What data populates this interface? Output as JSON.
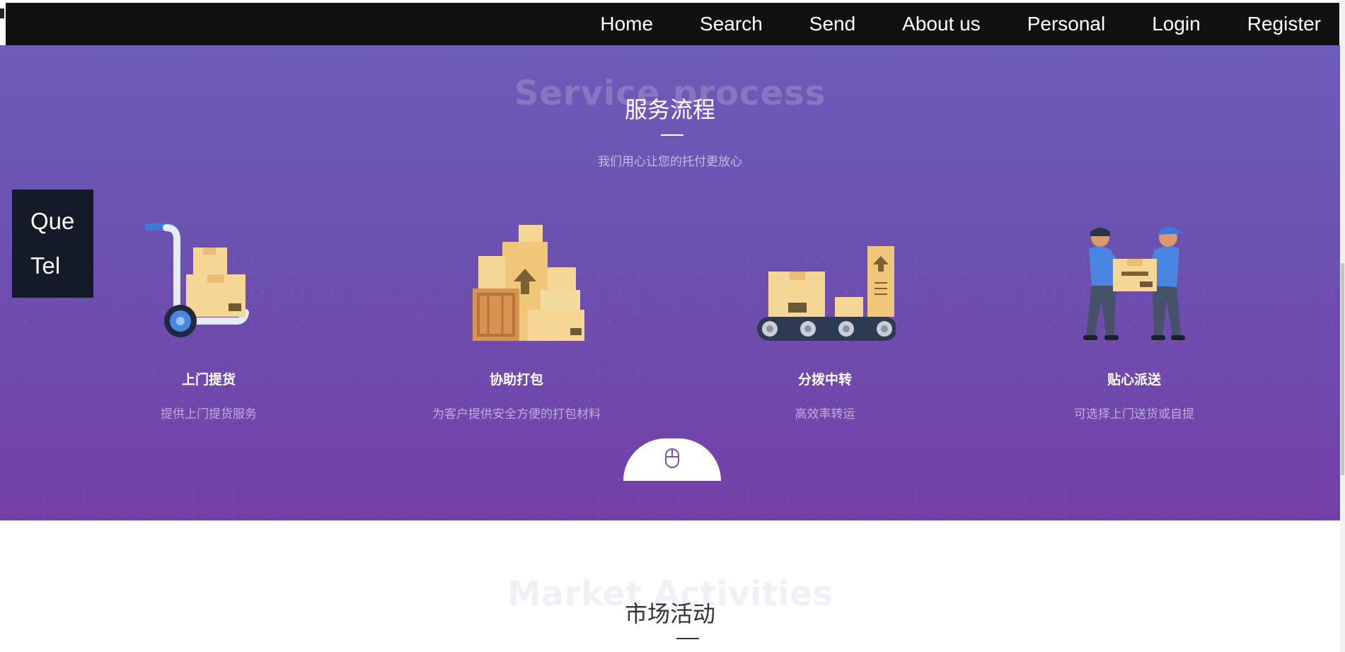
{
  "nav": {
    "items": [
      "Home",
      "Search",
      "Send",
      "About us",
      "Personal",
      "Login",
      "Register"
    ]
  },
  "contact": {
    "line1": "Que",
    "line2": "Tel"
  },
  "hero": {
    "bg_title": "Service process",
    "title": "服务流程",
    "subtitle": "我们用心让您的托付更放心",
    "services": [
      {
        "title": "上门提货",
        "desc": "提供上门提货服务",
        "icon": "hand-truck-icon"
      },
      {
        "title": "协助打包",
        "desc": "为客户提供安全方便的打包材料",
        "icon": "packages-icon"
      },
      {
        "title": "分拨中转",
        "desc": "高效率转运",
        "icon": "conveyor-icon"
      },
      {
        "title": "贴心派送",
        "desc": "可选择上门送货或自提",
        "icon": "delivery-people-icon"
      }
    ]
  },
  "market": {
    "bg_title": "Market Activities",
    "title": "市场活动"
  },
  "colors": {
    "nav_bg": "#111111",
    "hero_top": "#6d5cb8",
    "hero_bottom": "#7440a8",
    "contact_bg": "#151a28",
    "box": "#f4d690"
  }
}
